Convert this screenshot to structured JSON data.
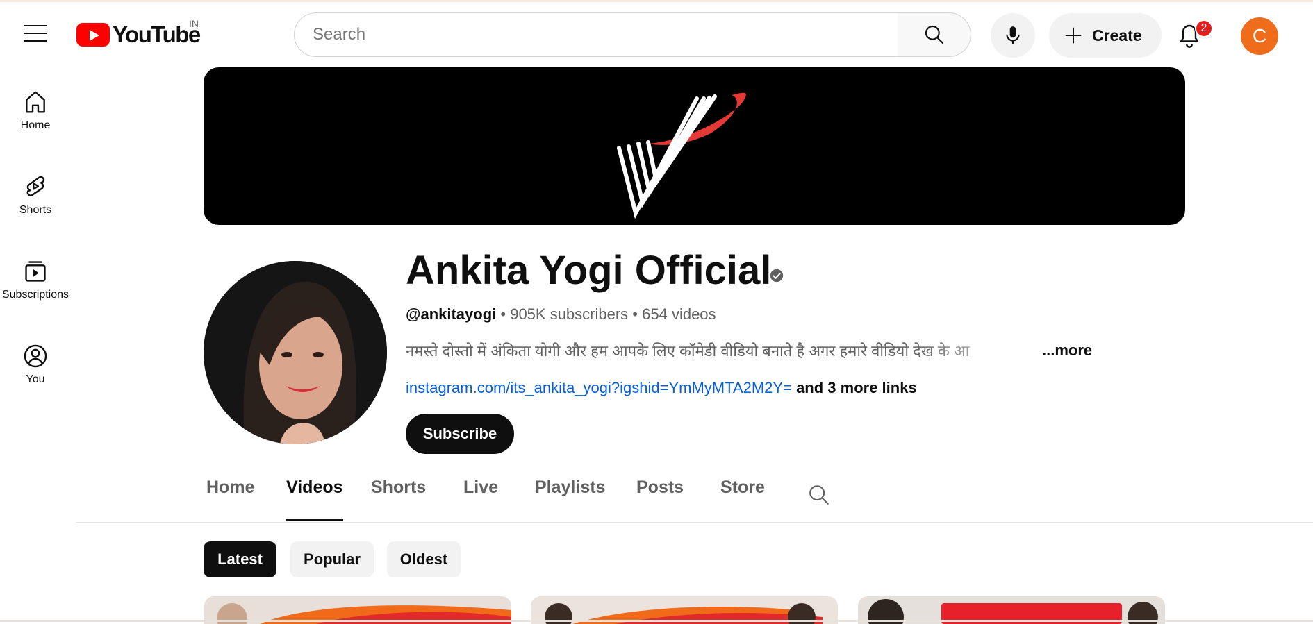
{
  "app": {
    "logo_text": "YouTube",
    "country_code": "IN"
  },
  "search": {
    "placeholder": "Search"
  },
  "header": {
    "create_label": "Create",
    "notification_count": "2",
    "user_initial": "C"
  },
  "guide": [
    {
      "label": "Home",
      "icon": "home-icon"
    },
    {
      "label": "Shorts",
      "icon": "shorts-icon"
    },
    {
      "label": "Subscriptions",
      "icon": "subscriptions-icon"
    },
    {
      "label": "You",
      "icon": "you-icon"
    }
  ],
  "channel": {
    "name": "Ankita Yogi Official",
    "handle": "@ankitayogi",
    "sep1": " • ",
    "subscribers": "905K subscribers",
    "sep2": " • ",
    "videos": "654 videos",
    "description": "नमस्ते दोस्तो में अंकिता योगी और हम आपके लिए कॉमेडी वीडियो बनाते है अगर हमारे वीडियो देख के आ",
    "more_label": "...more",
    "link": "instagram.com/its_ankita_yogi?igshid=YmMyMTA2M2Y=",
    "more_links": "and 3 more links",
    "subscribe_label": "Subscribe"
  },
  "tabs": [
    "Home",
    "Videos",
    "Shorts",
    "Live",
    "Playlists",
    "Posts",
    "Store"
  ],
  "active_tab": "Videos",
  "chips": [
    "Latest",
    "Popular",
    "Oldest"
  ],
  "active_chip": "Latest",
  "colors": {
    "brand_red": "#ff0000",
    "avatar_orange": "#ef6c1a",
    "link_blue": "#065fd4",
    "banner_logo_red": "#e53935"
  }
}
